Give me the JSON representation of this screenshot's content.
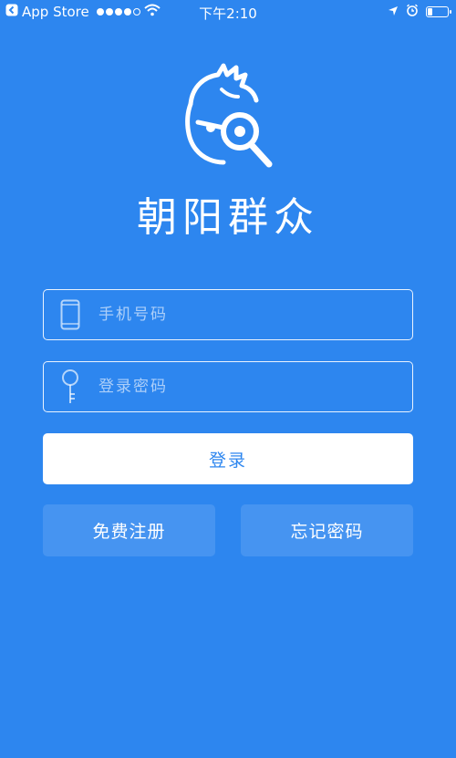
{
  "status_bar": {
    "back_app": "App Store",
    "time": "下午2:10",
    "signal_dots_filled": 4,
    "signal_dots_total": 5,
    "battery_level": 0.2
  },
  "branding": {
    "app_name": "朝阳群众",
    "logo_icon": "detective-face-magnifier-icon"
  },
  "form": {
    "phone": {
      "value": "",
      "placeholder": "手机号码",
      "icon": "phone-icon"
    },
    "password": {
      "value": "",
      "placeholder": "登录密码",
      "icon": "key-icon"
    }
  },
  "actions": {
    "login_label": "登录",
    "register_label": "免费注册",
    "forgot_label": "忘记密码"
  },
  "colors": {
    "background": "#2d86ef",
    "primary_text": "#ffffff",
    "login_button_text": "#2d86ef"
  }
}
